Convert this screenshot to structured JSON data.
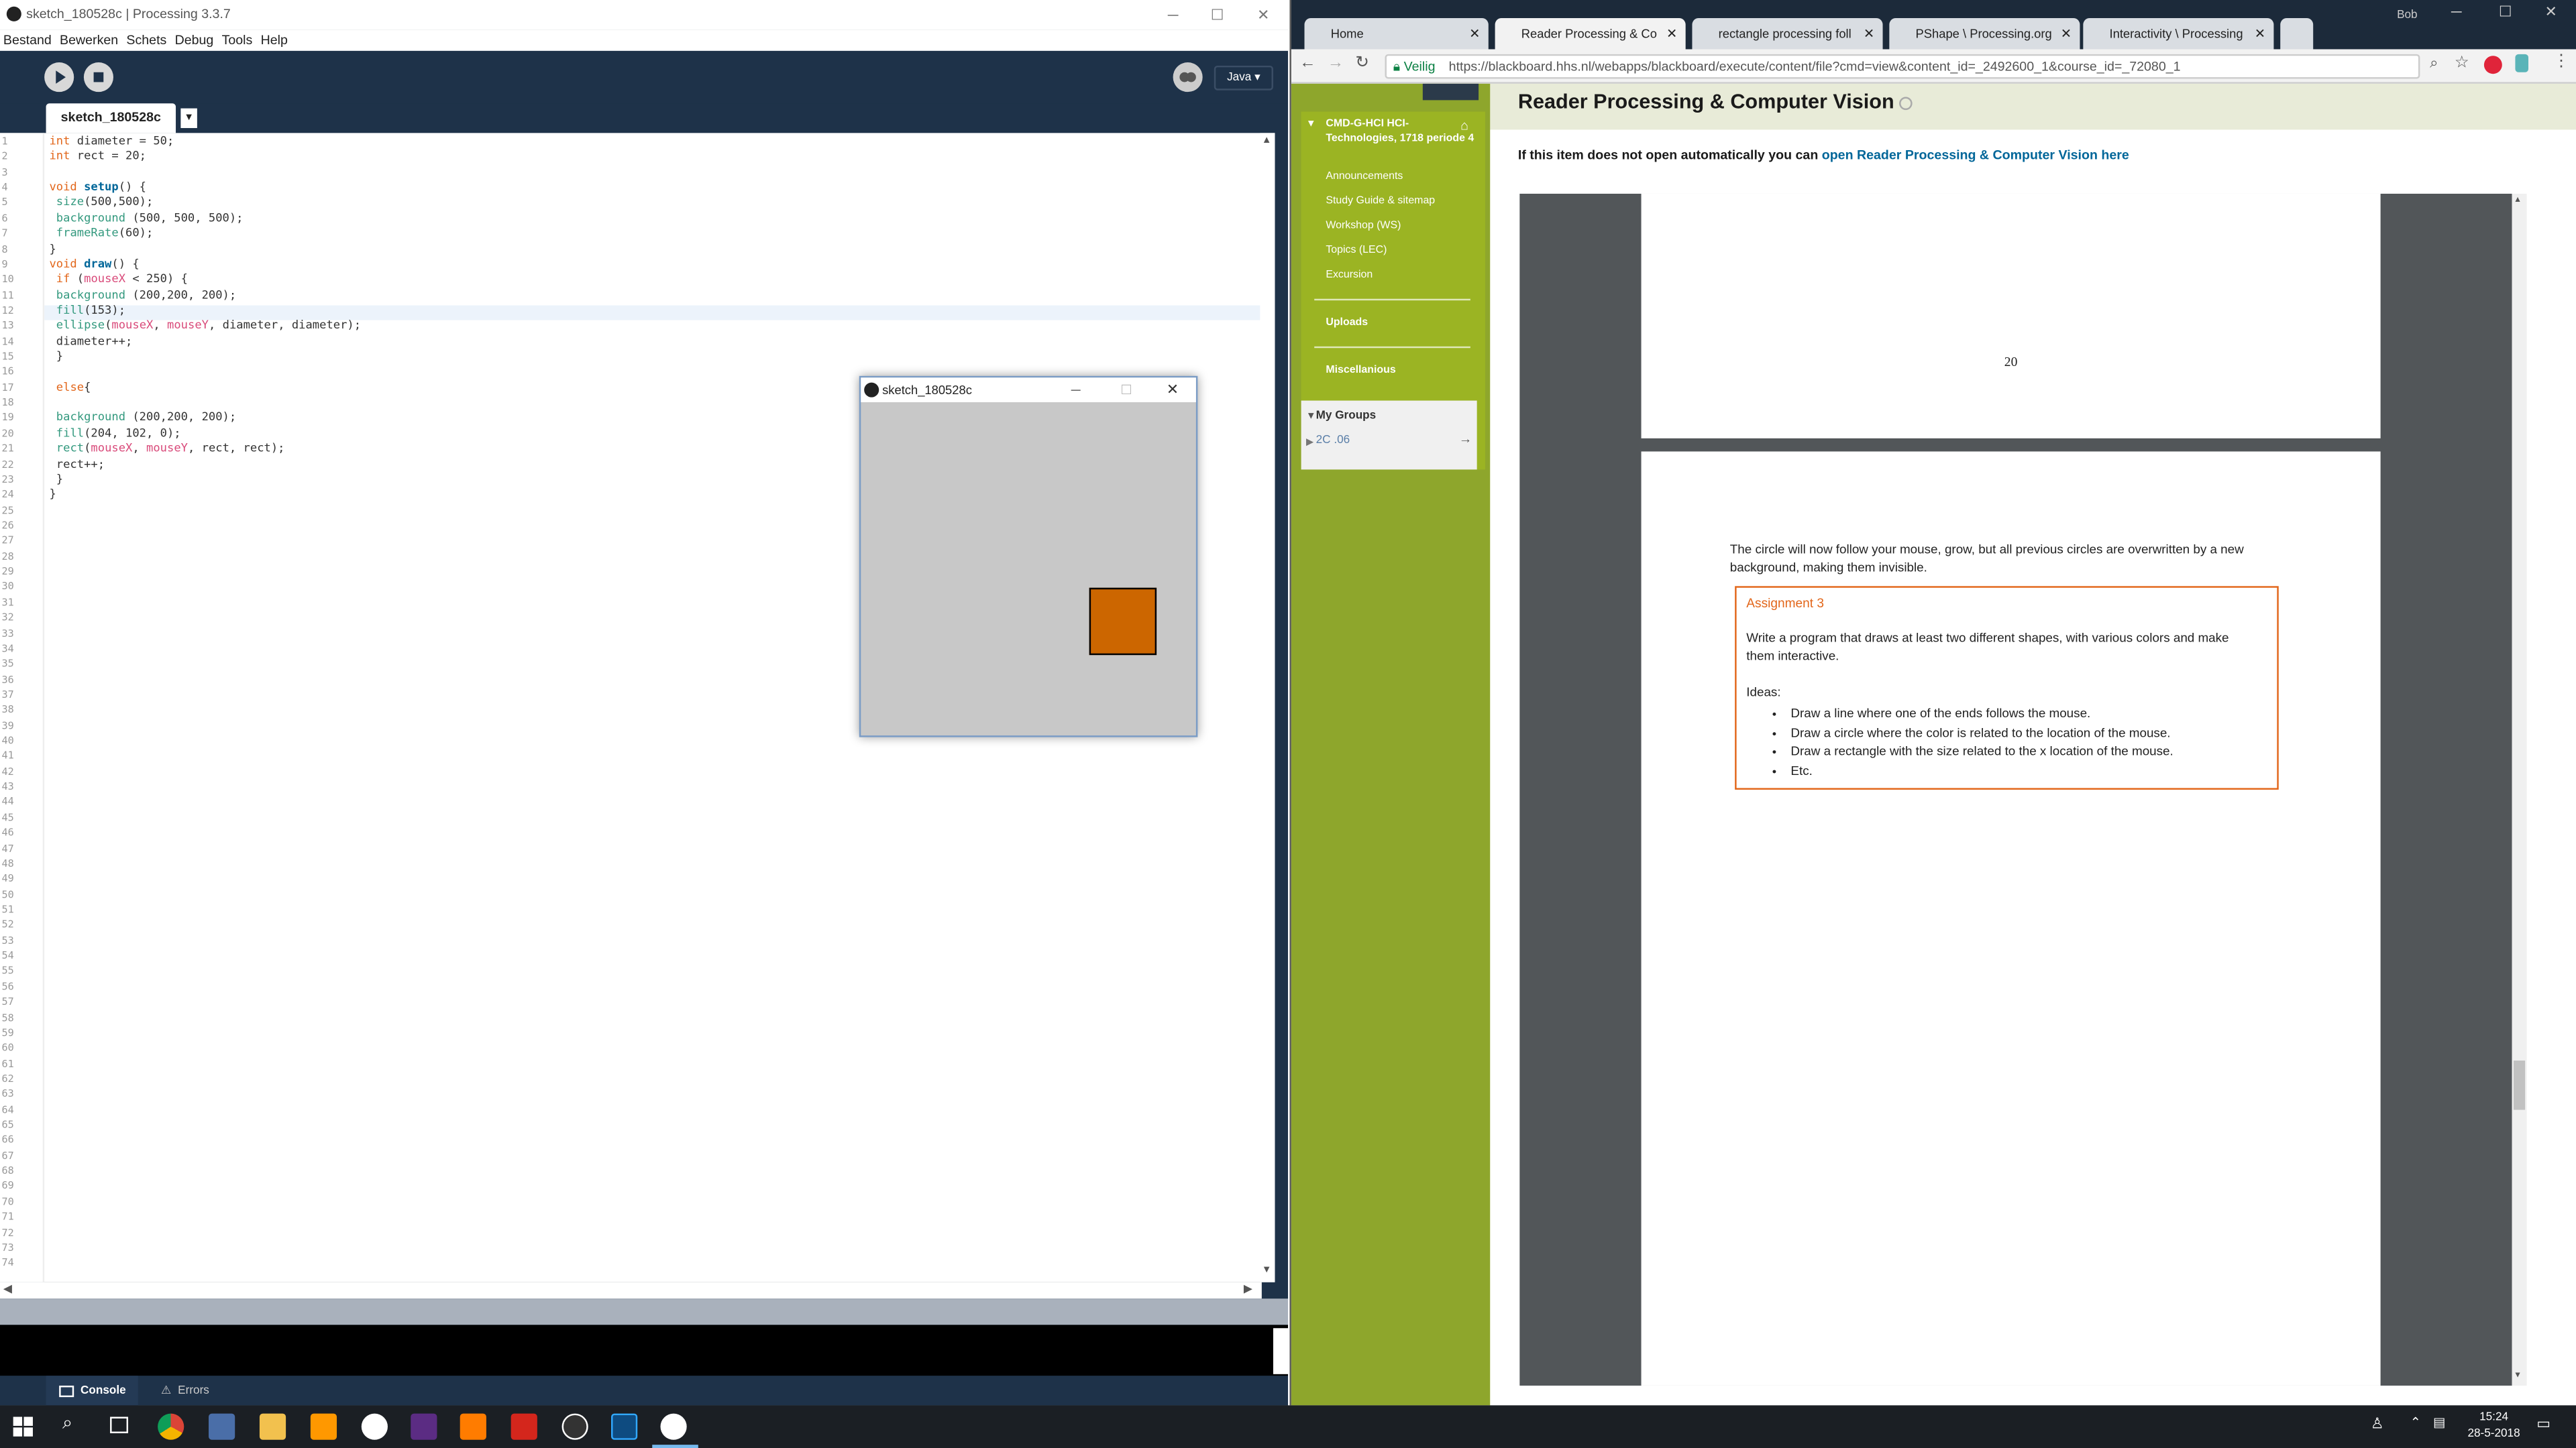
{
  "processing": {
    "window_title": "sketch_180528c | Processing 3.3.7",
    "menu": [
      "Bestand",
      "Bewerken",
      "Schets",
      "Debug",
      "Tools",
      "Help"
    ],
    "mode_label": "Java ▾",
    "tab_name": "sketch_180528c",
    "code_lines": [
      [
        {
          "t": "int",
          "c": "kw"
        },
        {
          "t": " diameter = 50;"
        }
      ],
      [
        {
          "t": "int",
          "c": "kw"
        },
        {
          "t": " rect = 20;"
        }
      ],
      [],
      [
        {
          "t": "void",
          "c": "kw"
        },
        {
          "t": " "
        },
        {
          "t": "setup",
          "c": "fn",
          "b": 1
        },
        {
          "t": "() {"
        }
      ],
      [
        {
          "t": " "
        },
        {
          "t": "size",
          "c": "vd"
        },
        {
          "t": "(500,500);"
        }
      ],
      [
        {
          "t": " "
        },
        {
          "t": "background",
          "c": "vd"
        },
        {
          "t": " (500, 500, 500);"
        }
      ],
      [
        {
          "t": " "
        },
        {
          "t": "frameRate",
          "c": "vd"
        },
        {
          "t": "(60);"
        }
      ],
      [
        {
          "t": "}"
        }
      ],
      [
        {
          "t": "void",
          "c": "kw"
        },
        {
          "t": " "
        },
        {
          "t": "draw",
          "c": "fn",
          "b": 1
        },
        {
          "t": "() {"
        }
      ],
      [
        {
          "t": " "
        },
        {
          "t": "if",
          "c": "kw"
        },
        {
          "t": " ("
        },
        {
          "t": "mouseX",
          "c": "mv"
        },
        {
          "t": " < 250) {"
        }
      ],
      [
        {
          "t": " "
        },
        {
          "t": "background",
          "c": "vd"
        },
        {
          "t": " (200,200, 200);"
        }
      ],
      [
        {
          "t": " "
        },
        {
          "t": "fill",
          "c": "vd"
        },
        {
          "t": "(153);"
        }
      ],
      [
        {
          "t": " "
        },
        {
          "t": "ellipse",
          "c": "vd"
        },
        {
          "t": "("
        },
        {
          "t": "mouseX",
          "c": "mv"
        },
        {
          "t": ", "
        },
        {
          "t": "mouseY",
          "c": "mv"
        },
        {
          "t": ", diameter, diameter);"
        }
      ],
      [
        {
          "t": " diameter++;"
        }
      ],
      [
        {
          "t": " }"
        }
      ],
      [],
      [
        {
          "t": " "
        },
        {
          "t": "else",
          "c": "kw"
        },
        {
          "t": "{"
        }
      ],
      [],
      [
        {
          "t": " "
        },
        {
          "t": "background",
          "c": "vd"
        },
        {
          "t": " (200,200, 200);"
        }
      ],
      [
        {
          "t": " "
        },
        {
          "t": "fill",
          "c": "vd"
        },
        {
          "t": "(204, 102, 0);"
        }
      ],
      [
        {
          "t": " "
        },
        {
          "t": "rect",
          "c": "vd"
        },
        {
          "t": "("
        },
        {
          "t": "mouseX",
          "c": "mv"
        },
        {
          "t": ", "
        },
        {
          "t": "mouseY",
          "c": "mv"
        },
        {
          "t": ", rect, rect);"
        }
      ],
      [
        {
          "t": " rect++;"
        }
      ],
      [
        {
          "t": " }"
        }
      ],
      [
        {
          "t": "}"
        }
      ]
    ],
    "line_count": 74,
    "console_tab": "Console",
    "errors_tab": "Errors"
  },
  "sketch_window": {
    "title": "sketch_180528c",
    "square_color": "#cc6600",
    "background_color": "#c8c8c8"
  },
  "browser": {
    "tabs": [
      {
        "label": "Home"
      },
      {
        "label": "Reader Processing & Co"
      },
      {
        "label": "rectangle processing foll"
      },
      {
        "label": "PShape \\ Processing.org"
      },
      {
        "label": "Interactivity \\ Processing"
      }
    ],
    "user_label": "Bob",
    "secure_label": "Veilig",
    "url": "https://blackboard.hhs.nl/webapps/blackboard/execute/content/file?cmd=view&content_id=_2492600_1&course_id=_72080_1",
    "course_title": "CMD-G-HCI HCI-Technologies, 1718 periode 4",
    "nav_items": [
      "Announcements",
      "Study Guide & sitemap",
      "Workshop (WS)",
      "Topics (LEC)",
      "Excursion"
    ],
    "nav_sections": [
      "Uploads",
      "Miscellanious"
    ],
    "my_groups": "My Groups",
    "group_item": "2C .06",
    "page_title": "Reader Processing & Computer Vision",
    "open_text": "If this item does not open automatically you can ",
    "open_link": "open Reader Processing & Computer Vision here",
    "pdf": {
      "page_number": "20",
      "paragraph": "The circle will now follow your mouse, grow, but all previous circles are overwritten by a new background, making them invisible.",
      "assignment_title": "Assignment 3",
      "assignment_text": "Write a program that draws at least two different shapes, with various colors and make them interactive.",
      "ideas_label": "Ideas:",
      "ideas": [
        "Draw a line where one of the ends follows the mouse.",
        "Draw a circle where the color is related to the location of the mouse.",
        "Draw a rectangle with the size related to the x location of the mouse.",
        "Etc."
      ]
    }
  },
  "taskbar": {
    "time": "15:24",
    "date": "28-5-2018"
  }
}
